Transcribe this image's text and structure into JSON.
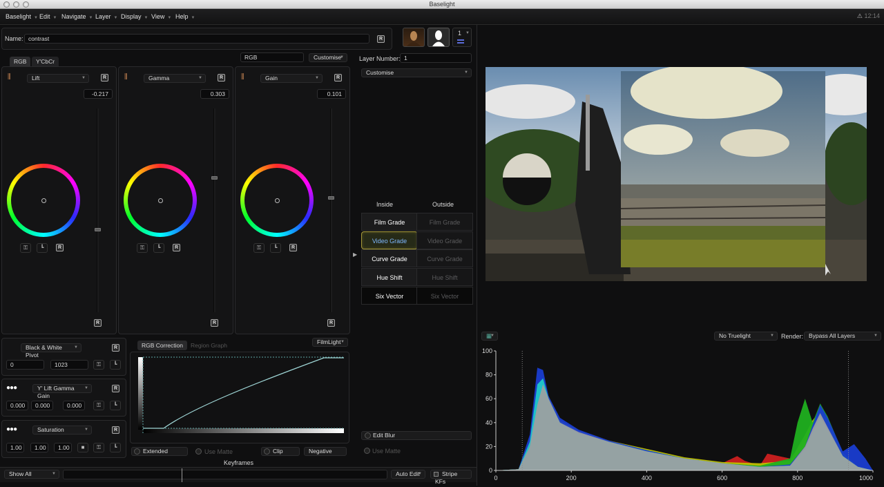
{
  "window": {
    "title": "Baselight"
  },
  "menu": {
    "items": [
      "Baselight",
      "Edit",
      "Navigate",
      "Layer",
      "Display",
      "View",
      "Help"
    ]
  },
  "status": {
    "time": "12:14"
  },
  "name_field": {
    "label": "Name:",
    "value": "contrast"
  },
  "layer_selector": {
    "number": "1"
  },
  "color_space_tabs": {
    "rgb": "RGB",
    "ycbcr": "Y'CbCr"
  },
  "color_space": {
    "value": "RGB",
    "customise": "Customise"
  },
  "wheels": [
    {
      "mode": "Lift",
      "value": "-0.217"
    },
    {
      "mode": "Gamma",
      "value": "0.303"
    },
    {
      "mode": "Gain",
      "value": "0.101"
    }
  ],
  "layer": {
    "label": "Layer Number:",
    "value": "1",
    "customise": "Customise"
  },
  "grade_columns": {
    "inside": "Inside",
    "outside": "Outside"
  },
  "grades": [
    {
      "inside": "Film Grade",
      "outside": "Film Grade"
    },
    {
      "inside": "Video Grade",
      "outside": "Video Grade"
    },
    {
      "inside": "Curve Grade",
      "outside": "Curve Grade"
    },
    {
      "inside": "Hue Shift",
      "outside": "Hue Shift"
    },
    {
      "inside": "Six Vector",
      "outside": "Six Vector"
    }
  ],
  "bw_pivot": {
    "mode": "Black & White Pivot",
    "low": "0",
    "high": "1023"
  },
  "y_lift": {
    "mode": "Y' Lift Gamma Gain",
    "values": [
      "0.000",
      "0.000",
      "0.000"
    ]
  },
  "saturation": {
    "mode": "Saturation",
    "values": [
      "1.00",
      "1.00",
      "1.00"
    ]
  },
  "graph_tabs": {
    "rgb_correction": "RGB Correction",
    "region_graph": "Region Graph",
    "filmlight": "FilmLight"
  },
  "graph_options": {
    "extended": "Extended",
    "use_matte": "Use Matte",
    "clip": "Clip",
    "negative": "Negative"
  },
  "blur": {
    "edit_blur": "Edit Blur",
    "use_matte": "Use Matte"
  },
  "keyframes": {
    "label": "Keyframes",
    "show_all": "Show All",
    "auto_edit": "Auto Edit",
    "stripe": "Stripe KFs"
  },
  "viewer": {
    "truelight": "No Truelight",
    "render_label": "Render:",
    "render": "Bypass All Layers"
  },
  "chart_data": {
    "type": "area",
    "x_ticks": [
      "0",
      "200",
      "400",
      "600",
      "800",
      "1000"
    ],
    "y_ticks": [
      "100",
      "80",
      "60",
      "40",
      "20",
      "0"
    ],
    "xlim": [
      0,
      1000
    ],
    "ylim": [
      0,
      100
    ],
    "grid": false,
    "series": [
      {
        "color": "#a0a0a0",
        "x": [
          0,
          60,
          90,
          110,
          125,
          140,
          170,
          220,
          300,
          400,
          500,
          600,
          700,
          780,
          820,
          840,
          860,
          880,
          920,
          960,
          1000
        ],
        "y": [
          0,
          1,
          20,
          55,
          72,
          60,
          40,
          32,
          24,
          16,
          10,
          6,
          3,
          4,
          20,
          35,
          48,
          36,
          12,
          3,
          0
        ]
      },
      {
        "color": "#c0c000",
        "x": [
          0,
          60,
          90,
          110,
          125,
          140,
          170,
          220,
          300,
          400,
          500,
          600,
          700,
          780,
          820,
          840,
          860,
          880,
          920,
          960,
          1000
        ],
        "y": [
          0,
          1,
          22,
          60,
          74,
          62,
          42,
          33,
          25,
          18,
          11,
          7,
          6,
          8,
          30,
          42,
          50,
          38,
          12,
          3,
          0
        ]
      },
      {
        "color": "#cc2020",
        "x": [
          0,
          60,
          90,
          110,
          125,
          140,
          170,
          220,
          300,
          400,
          500,
          600,
          640,
          660,
          700,
          720,
          780,
          820,
          840,
          860,
          880,
          920,
          960,
          1000
        ],
        "y": [
          0,
          1,
          25,
          70,
          72,
          58,
          38,
          30,
          22,
          16,
          10,
          6,
          12,
          8,
          4,
          14,
          10,
          25,
          38,
          50,
          40,
          12,
          3,
          0
        ]
      },
      {
        "color": "#20b020",
        "x": [
          0,
          60,
          90,
          110,
          125,
          140,
          170,
          220,
          300,
          400,
          500,
          600,
          700,
          780,
          800,
          820,
          840,
          860,
          880,
          920,
          960,
          1000
        ],
        "y": [
          0,
          1,
          21,
          62,
          78,
          60,
          40,
          32,
          24,
          17,
          10,
          6,
          4,
          10,
          40,
          60,
          40,
          56,
          45,
          15,
          3,
          0
        ]
      },
      {
        "color": "#1a3dd0",
        "x": [
          0,
          60,
          90,
          110,
          125,
          140,
          170,
          220,
          300,
          400,
          500,
          600,
          700,
          780,
          820,
          840,
          860,
          880,
          920,
          950,
          980,
          1000
        ],
        "y": [
          0,
          1,
          30,
          86,
          84,
          62,
          44,
          34,
          25,
          17,
          10,
          6,
          3,
          5,
          20,
          38,
          55,
          44,
          16,
          22,
          10,
          0
        ]
      },
      {
        "color": "#20c8c8",
        "x": [
          0,
          60,
          90,
          110,
          125,
          140,
          170,
          220,
          300,
          400,
          500,
          600,
          700,
          780,
          820,
          840,
          860,
          880,
          920,
          960,
          1000
        ],
        "y": [
          0,
          1,
          24,
          72,
          77,
          60,
          40,
          31,
          24,
          16,
          10,
          6,
          3,
          4,
          18,
          32,
          45,
          34,
          12,
          3,
          0
        ]
      }
    ]
  },
  "colors": {
    "accent": "#a59a3a",
    "selected_text": "#7fb8ff",
    "curve": "#9fd6d6"
  }
}
